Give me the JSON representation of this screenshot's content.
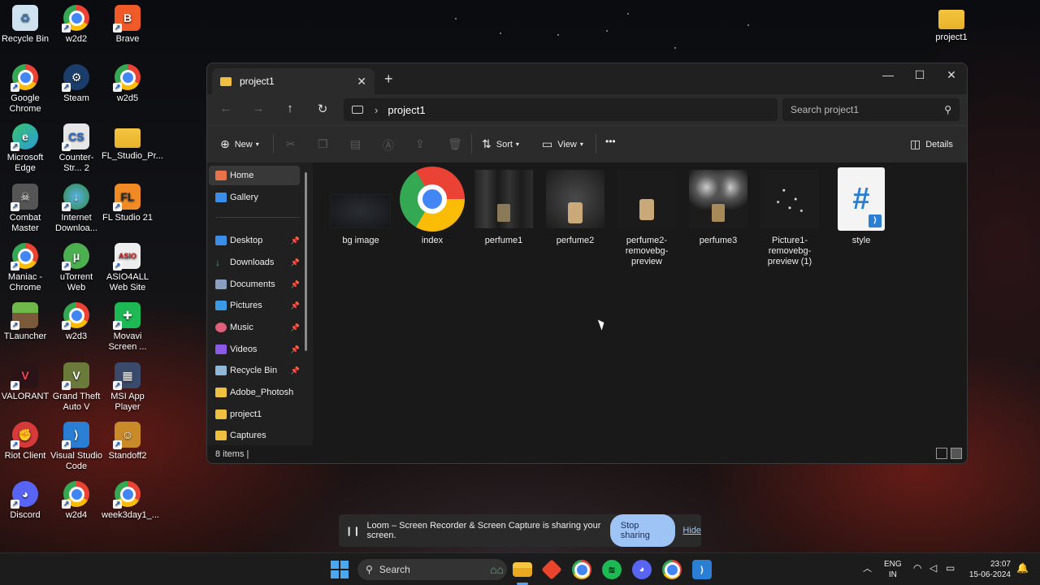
{
  "desktop_icons": [
    {
      "label": "Recycle Bin",
      "icon": "recycle-bin-icon",
      "color": "#8fb8d8"
    },
    {
      "label": "w2d2",
      "icon": "chrome-icon"
    },
    {
      "label": "Brave",
      "icon": "brave-icon",
      "color": "#f05a28"
    },
    {
      "label": "Google Chrome",
      "icon": "chrome-icon"
    },
    {
      "label": "Steam",
      "icon": "steam-icon",
      "color": "#1b3d6b"
    },
    {
      "label": "w2d5",
      "icon": "chrome-icon"
    },
    {
      "label": "Microsoft Edge",
      "icon": "edge-icon",
      "color": "#2a9bd8"
    },
    {
      "label": "Counter-Str... 2",
      "icon": "counter-strike-icon",
      "color": "#2a6fc9"
    },
    {
      "label": "FL_Studio_Pr...",
      "icon": "folder-icon"
    },
    {
      "label": "Combat Master",
      "icon": "combat-master-icon",
      "color": "#444"
    },
    {
      "label": "Internet Downloa...",
      "icon": "internet-download-manager-icon",
      "color": "#2f8a3c"
    },
    {
      "label": "FL Studio 21",
      "icon": "fl-studio-icon",
      "color": "#f08a24"
    },
    {
      "label": "Maniac - Chrome",
      "icon": "chrome-icon"
    },
    {
      "label": "uTorrent Web",
      "icon": "utorrent-icon",
      "color": "#4caf50"
    },
    {
      "label": "ASIO4ALL Web Site",
      "icon": "asio4all-icon",
      "color": "#b22"
    },
    {
      "label": "TLauncher",
      "icon": "tlauncher-icon",
      "color": "#5c9e3a"
    },
    {
      "label": "w2d3",
      "icon": "chrome-icon"
    },
    {
      "label": "Movavi Screen ...",
      "icon": "movavi-icon",
      "color": "#1db954"
    },
    {
      "label": "VALORANT",
      "icon": "valorant-icon",
      "color": "#2a1418"
    },
    {
      "label": "Grand Theft Auto V",
      "icon": "gta-icon",
      "color": "#6a7a3a"
    },
    {
      "label": "MSI App Player",
      "icon": "msi-app-player-icon",
      "color": "#3a4a6a"
    },
    {
      "label": "Riot Client",
      "icon": "riot-client-icon",
      "color": "#d63a3a"
    },
    {
      "label": "Visual Studio Code",
      "icon": "vscode-icon",
      "color": "#2a7fd4"
    },
    {
      "label": "Standoff2",
      "icon": "standoff2-icon",
      "color": "#c98a2a"
    },
    {
      "label": "Discord",
      "icon": "discord-icon",
      "color": "#5865f2"
    },
    {
      "label": "w2d4",
      "icon": "chrome-icon"
    },
    {
      "label": "week3day1_...",
      "icon": "chrome-icon"
    },
    {
      "label": "project1",
      "icon": "folder-icon"
    }
  ],
  "explorer": {
    "tab_title": "project1",
    "new_tab": "+",
    "window_controls": {
      "minimize": "—",
      "maximize": "☐",
      "close": "✕"
    },
    "address": {
      "crumb": "project1"
    },
    "search_placeholder": "Search project1",
    "toolbar": {
      "new": "New",
      "sort": "Sort",
      "view": "View",
      "more": "•••",
      "details": "Details"
    },
    "sidebar": [
      {
        "label": "Home",
        "icon": "home-icon",
        "color": "#e8734a",
        "active": true
      },
      {
        "label": "Gallery",
        "icon": "gallery-icon",
        "color": "#3a8ee6"
      },
      {
        "label": "Desktop",
        "icon": "desktop-icon",
        "color": "#3a8ee6",
        "pinned": true
      },
      {
        "label": "Downloads",
        "icon": "downloads-icon",
        "color": "#3ab07a",
        "pinned": true
      },
      {
        "label": "Documents",
        "icon": "documents-icon",
        "color": "#8aa0c0",
        "pinned": true
      },
      {
        "label": "Pictures",
        "icon": "pictures-icon",
        "color": "#3a9ae6",
        "pinned": true
      },
      {
        "label": "Music",
        "icon": "music-icon",
        "color": "#e0607a",
        "pinned": true
      },
      {
        "label": "Videos",
        "icon": "videos-icon",
        "color": "#8a5ae6",
        "pinned": true
      },
      {
        "label": "Recycle Bin",
        "icon": "recycle-bin-icon",
        "color": "#8fb8d8",
        "pinned": true
      },
      {
        "label": "Adobe_Photosh",
        "icon": "folder-icon",
        "color": "#f0c040"
      },
      {
        "label": "project1",
        "icon": "folder-icon",
        "color": "#f0c040"
      },
      {
        "label": "Captures",
        "icon": "folder-icon",
        "color": "#f0c040"
      }
    ],
    "files": [
      {
        "name": "bg image",
        "kind": "dark-image-thumbnail"
      },
      {
        "name": "index",
        "kind": "chrome-icon"
      },
      {
        "name": "perfume1",
        "kind": "perfume-thumbnail"
      },
      {
        "name": "perfume2",
        "kind": "perfume-thumbnail"
      },
      {
        "name": "perfume2-removebg-preview",
        "kind": "perfume-thumbnail"
      },
      {
        "name": "perfume3",
        "kind": "perfume-thumbnail"
      },
      {
        "name": "Picture1-removebg-preview (1)",
        "kind": "particles-thumbnail"
      },
      {
        "name": "style",
        "kind": "css-file-icon"
      }
    ],
    "status": "8 items  |"
  },
  "loom": {
    "pause_icon": "❙❙",
    "message": "Loom – Screen Recorder & Screen Capture is sharing your screen.",
    "stop": "Stop sharing",
    "hide": "Hide"
  },
  "taskbar": {
    "search": "Search",
    "lang_1": "ENG",
    "lang_2": "IN",
    "time": "23:07",
    "date": "15-06-2024"
  }
}
